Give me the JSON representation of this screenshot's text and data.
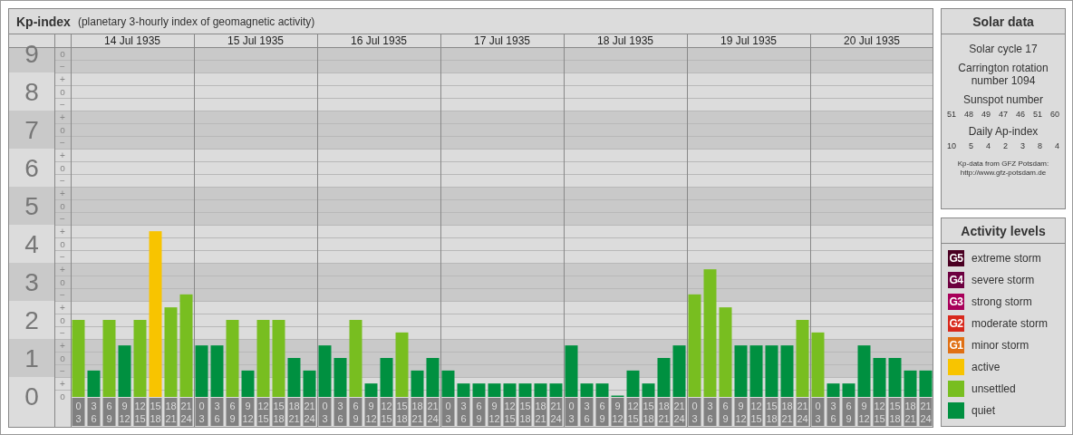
{
  "kp_panel": {
    "title": "Kp-index",
    "subtitle": "(planetary 3-hourly index of geomagnetic activity)",
    "dates": [
      "14 Jul 1935",
      "15 Jul 1935",
      "16 Jul 1935",
      "17 Jul 1935",
      "18 Jul 1935",
      "19 Jul 1935",
      "20 Jul 1935"
    ],
    "minor_ticks": [
      "o",
      "−",
      "+",
      "o",
      "−",
      "+",
      "o",
      "−",
      "+",
      "o",
      "−",
      "+",
      "o",
      "−",
      "+",
      "o",
      "−",
      "+",
      "o",
      "−",
      "+",
      "o",
      "−",
      "+",
      "o",
      "−",
      "+",
      "o"
    ],
    "chart_data": {
      "type": "bar",
      "grid": true,
      "ylim": [
        0,
        9
      ],
      "yticks": [
        0,
        1,
        2,
        3,
        4,
        5,
        6,
        7,
        8,
        9
      ],
      "categories": [
        "0 3",
        "3 6",
        "6 9",
        "9 12",
        "12 15",
        "15 18",
        "18 21",
        "21 24",
        "0 3",
        "3 6",
        "6 9",
        "9 12",
        "12 15",
        "15 18",
        "18 21",
        "21 24",
        "0 3",
        "3 6",
        "6 9",
        "9 12",
        "12 15",
        "15 18",
        "18 21",
        "21 24",
        "0 3",
        "3 6",
        "6 9",
        "9 12",
        "12 15",
        "15 18",
        "18 21",
        "21 24",
        "0 3",
        "3 6",
        "6 9",
        "9 12",
        "12 15",
        "15 18",
        "18 21",
        "21 24",
        "0 3",
        "3 6",
        "6 9",
        "9 12",
        "12 15",
        "15 18",
        "18 21",
        "21 24",
        "0 3",
        "3 6",
        "6 9",
        "9 12",
        "12 15",
        "15 18",
        "18 21",
        "21 24"
      ],
      "series": [
        {
          "color": "#f8c400",
          "values": [
            null,
            null,
            null,
            null,
            null,
            4.33,
            null,
            null,
            null,
            null,
            null,
            null,
            null,
            null,
            null,
            null,
            null,
            null,
            null,
            null,
            null,
            null,
            null,
            null,
            null,
            null,
            null,
            null,
            null,
            null,
            null,
            null,
            null,
            null,
            null,
            null,
            null,
            null,
            null,
            null,
            null,
            null,
            null,
            null,
            null,
            null,
            null,
            null,
            null,
            null,
            null,
            null,
            null,
            null,
            null,
            null
          ]
        },
        {
          "color": "#78be20",
          "values": [
            2,
            null,
            2,
            null,
            2,
            null,
            2.33,
            2.67,
            null,
            null,
            2,
            null,
            2,
            2,
            null,
            null,
            null,
            null,
            2,
            null,
            null,
            1.67,
            null,
            null,
            null,
            null,
            null,
            null,
            null,
            null,
            null,
            null,
            null,
            null,
            null,
            null,
            null,
            null,
            null,
            null,
            2.67,
            3.33,
            2.33,
            null,
            null,
            null,
            null,
            2,
            1.67,
            null,
            null,
            null,
            null,
            null,
            null,
            null
          ]
        },
        {
          "color": "#009040",
          "values": [
            null,
            0.67,
            null,
            1.33,
            null,
            null,
            null,
            null,
            1.33,
            1.33,
            null,
            0.67,
            null,
            null,
            1,
            0.67,
            1.33,
            1,
            null,
            0.33,
            1,
            null,
            0.67,
            1,
            0.67,
            0.33,
            0.33,
            0.33,
            0.33,
            0.33,
            0.33,
            0.33,
            1.33,
            0.33,
            0.33,
            0,
            0.67,
            0.33,
            1,
            1.33,
            null,
            null,
            null,
            1.33,
            1.33,
            1.33,
            1.33,
            null,
            null,
            0.33,
            0.33,
            1.33,
            1,
            1,
            0.67,
            0.67
          ]
        }
      ]
    }
  },
  "solar_data": {
    "title": "Solar data",
    "cycle": "Solar cycle 17",
    "carrington": "Carrington rotation number 1094",
    "sunspot_heading": "Sunspot number",
    "sunspot_numbers": [
      "51",
      "48",
      "49",
      "47",
      "46",
      "51",
      "60"
    ],
    "ap_heading": "Daily Ap-index",
    "ap_values": [
      "10",
      "5",
      "4",
      "2",
      "3",
      "8",
      "4"
    ],
    "credit": "Kp-data from GFZ Potsdam:",
    "credit_url": "http://www.gfz-potsdam.de"
  },
  "activity_levels": {
    "title": "Activity levels",
    "items": [
      {
        "badge": "G5",
        "label": "extreme storm",
        "color": "#4a0022"
      },
      {
        "badge": "G4",
        "label": "severe storm",
        "color": "#6c0040"
      },
      {
        "badge": "G3",
        "label": "strong storm",
        "color": "#a8005a"
      },
      {
        "badge": "G2",
        "label": "moderate storm",
        "color": "#d8281c"
      },
      {
        "badge": "G1",
        "label": "minor storm",
        "color": "#e07014"
      },
      {
        "label": "active",
        "color": "#f8c400"
      },
      {
        "label": "unsettled",
        "color": "#78be20"
      },
      {
        "label": "quiet",
        "color": "#009040"
      }
    ]
  }
}
